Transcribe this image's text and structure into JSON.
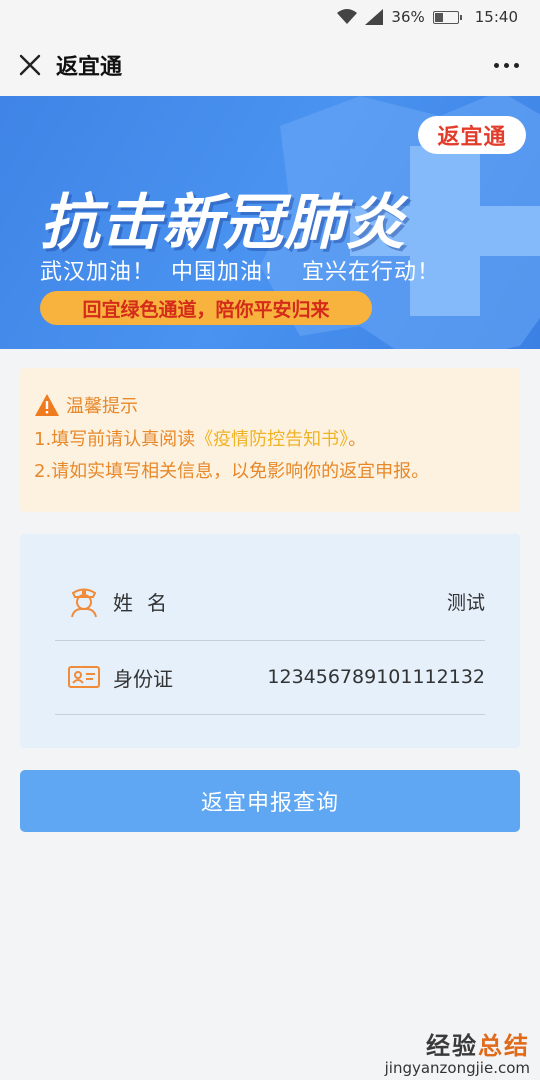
{
  "status_bar": {
    "battery": "36%",
    "time": "15:40"
  },
  "header": {
    "title": "返宜通",
    "close_icon": "close-icon",
    "more_icon": "more-dots-icon"
  },
  "banner": {
    "badge": "返宜通",
    "title": "抗击新冠肺炎",
    "slogan": "武汉加油！  中国加油！  宜兴在行动！",
    "pill": "回宜绿色通道，陪你平安归来",
    "colors": {
      "background": "#4a93f0",
      "pill": "#f7b33d",
      "pill_text": "#d42b1a"
    }
  },
  "notice": {
    "title": "温馨提示",
    "line1_prefix": "1.填写前请认真阅读",
    "line1_link": "《疫情防控告知书》",
    "line1_suffix": "。",
    "line2": "2.请如实填写相关信息，以免影响你的返宜申报。",
    "color": "#e7892a"
  },
  "info": {
    "name_label": "姓名",
    "name_value": "测试",
    "id_label": "身份证",
    "id_value": "12345678910111213​2"
  },
  "query_button": {
    "label": "返宜申报查询",
    "color": "#5fa7f3"
  },
  "watermark": {
    "title_a": "经验",
    "title_b": "总结",
    "url": "jingyanzongjie.com"
  }
}
